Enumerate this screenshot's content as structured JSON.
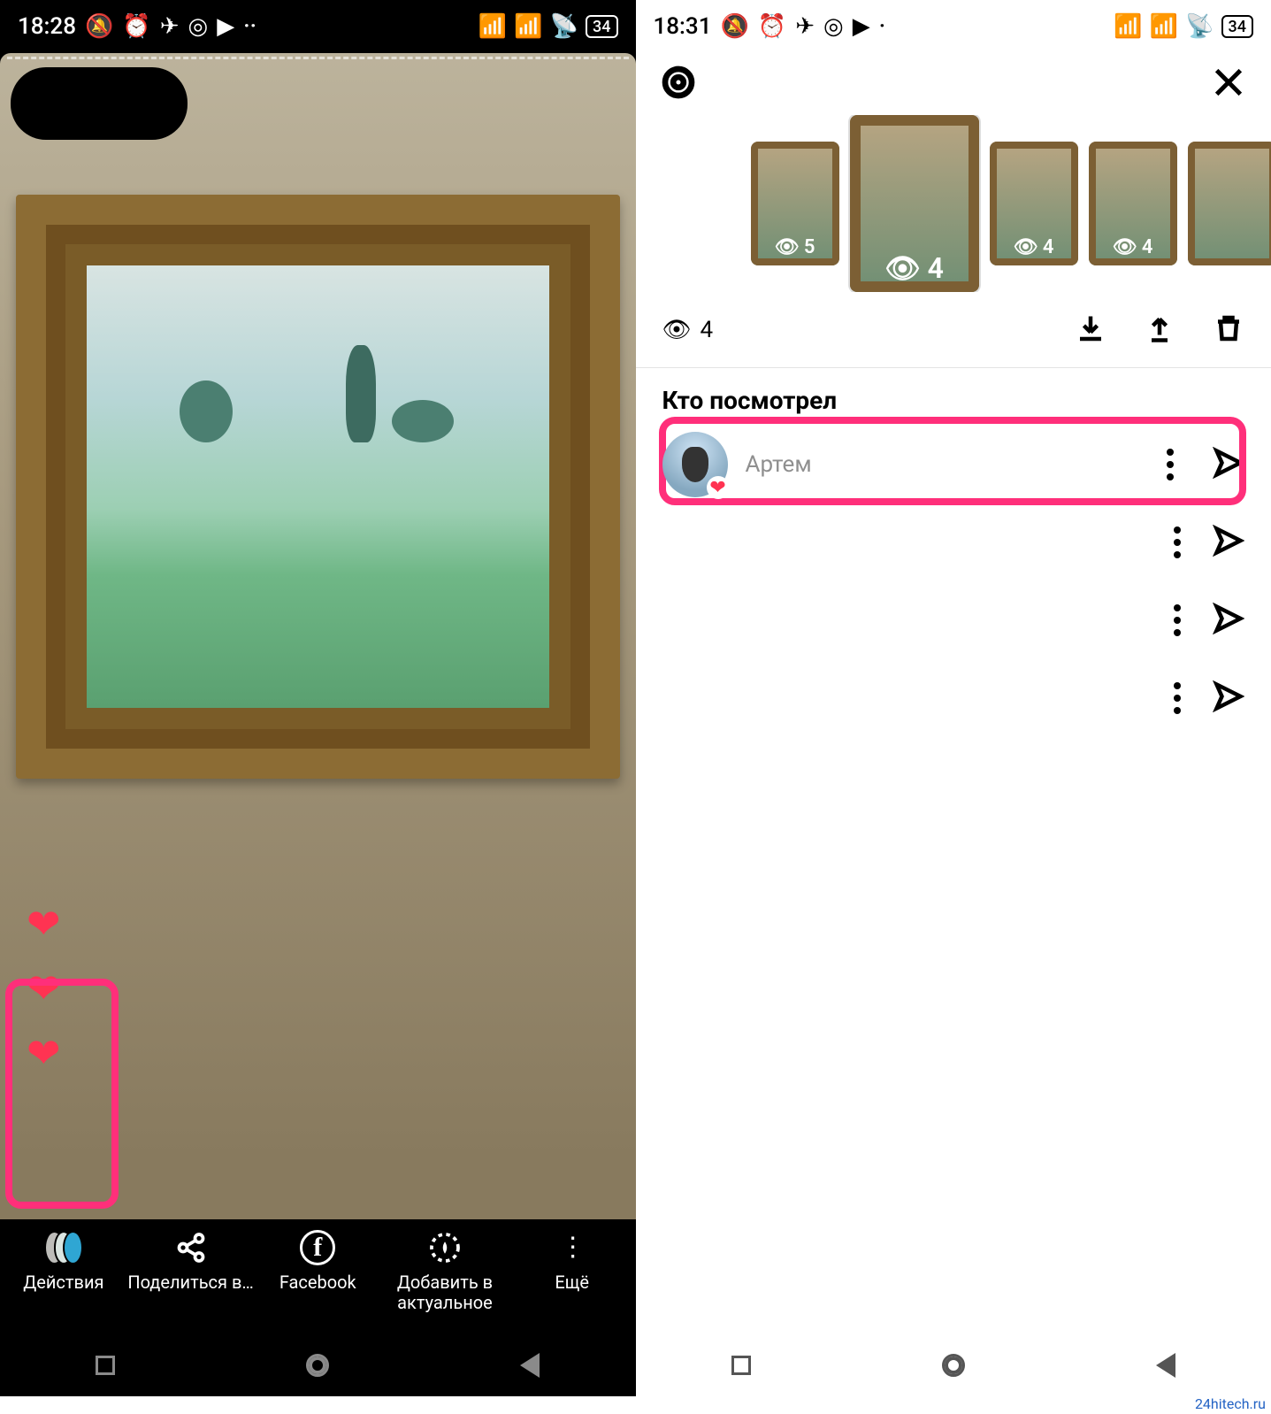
{
  "left": {
    "statusbar": {
      "time": "18:28",
      "battery": "34"
    },
    "bottom": {
      "activity": "Действия",
      "share": "Поделиться в…",
      "facebook": "Facebook",
      "highlight": "Добавить в актуальное",
      "more": "Ещё"
    }
  },
  "right": {
    "statusbar": {
      "time": "18:31",
      "battery": "34"
    },
    "thumbs": [
      {
        "views": "5"
      },
      {
        "views": "4"
      },
      {
        "views": "4"
      },
      {
        "views": "4"
      },
      {
        "views": ""
      }
    ],
    "current_views": "4",
    "section_title": "Кто посмотрел",
    "viewers": [
      {
        "name": "Артем",
        "liked": true
      },
      {
        "name": "",
        "liked": false
      },
      {
        "name": "",
        "liked": false
      },
      {
        "name": "",
        "liked": false
      }
    ]
  },
  "watermark": "24hitech.ru",
  "icons": {
    "eye": "👁",
    "heart": "❤"
  }
}
